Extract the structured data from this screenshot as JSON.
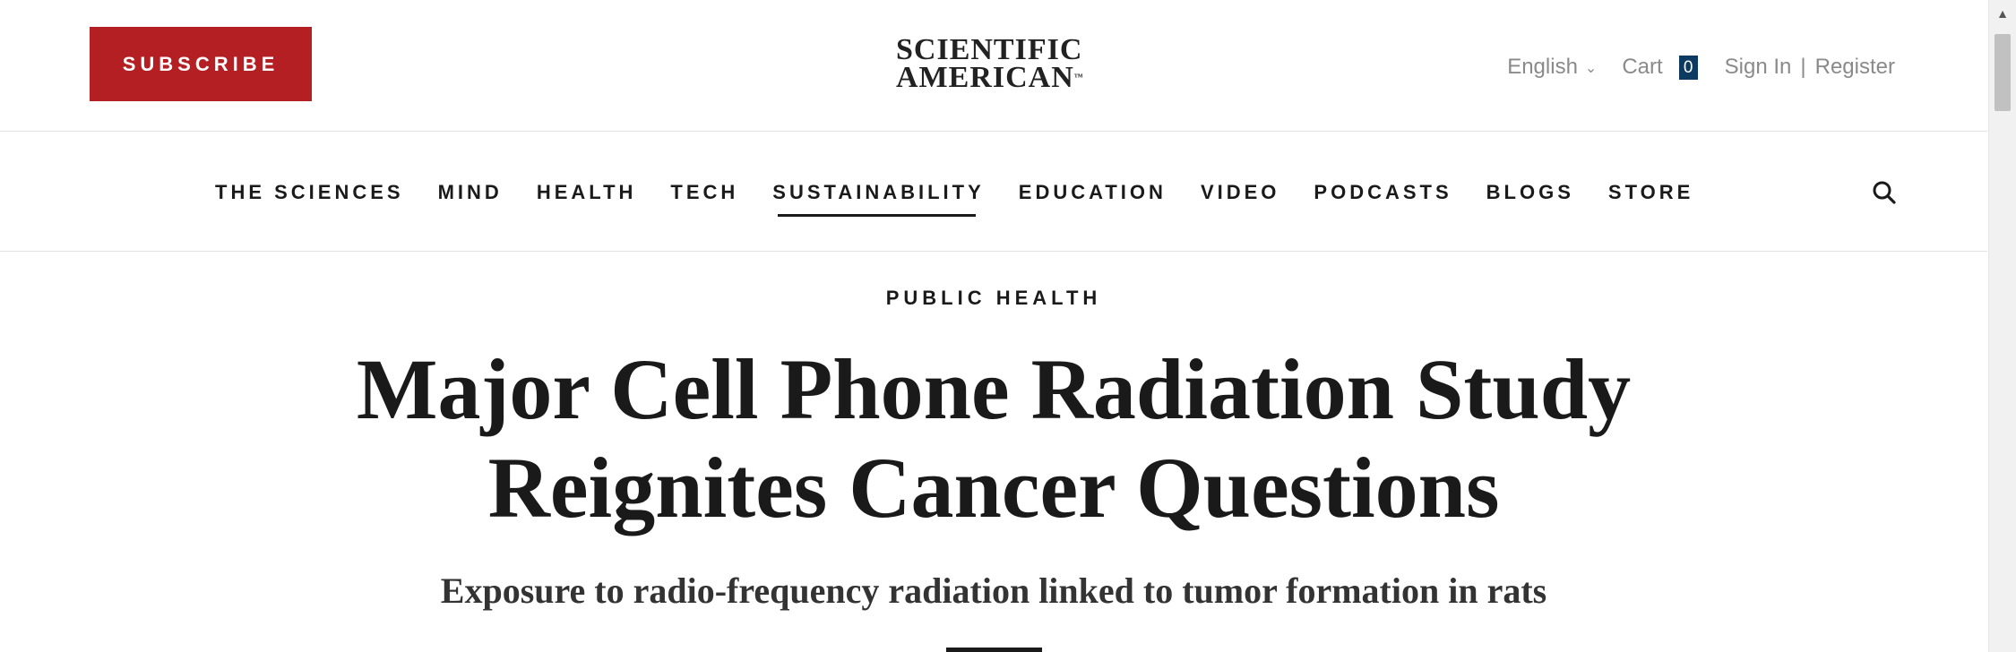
{
  "header": {
    "subscribe_label": "SUBSCRIBE",
    "logo_line1": "SCIENTIFIC",
    "logo_line2": "AMERICAN",
    "logo_tm": "™",
    "language": "English",
    "language_chevron": "⌄",
    "cart_label": "Cart",
    "cart_count": "0",
    "sign_in": "Sign In",
    "separator": "|",
    "register": "Register"
  },
  "nav": {
    "items": [
      {
        "label": "THE SCIENCES"
      },
      {
        "label": "MIND"
      },
      {
        "label": "HEALTH"
      },
      {
        "label": "TECH"
      },
      {
        "label": "SUSTAINABILITY",
        "active": true
      },
      {
        "label": "EDUCATION"
      },
      {
        "label": "VIDEO"
      },
      {
        "label": "PODCASTS"
      },
      {
        "label": "BLOGS"
      },
      {
        "label": "STORE"
      }
    ],
    "search_icon": "search-icon"
  },
  "article": {
    "kicker": "PUBLIC HEALTH",
    "headline_line1": "Major Cell Phone Radiation Study",
    "headline_line2": "Reignites Cancer Questions",
    "dek": "Exposure to radio-frequency radiation linked to tumor formation in rats"
  },
  "colors": {
    "subscribe_bg": "#b41f24",
    "cart_badge_bg": "#0d3a61",
    "text": "#1a1a1a",
    "muted": "#8a8a8a"
  }
}
